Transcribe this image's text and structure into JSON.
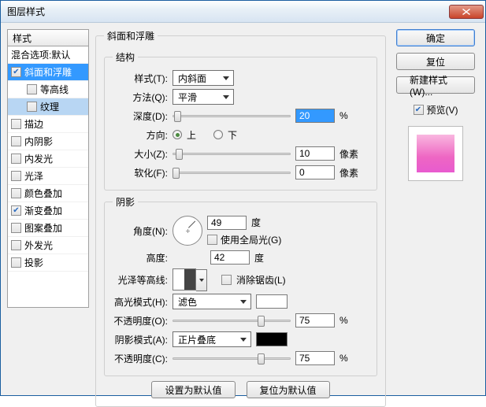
{
  "window": {
    "title": "图层样式"
  },
  "sidebar": {
    "header": "样式",
    "items": [
      {
        "label": "混合选项:默认",
        "checked": null
      },
      {
        "label": "斜面和浮雕",
        "checked": true
      },
      {
        "label": "等高线",
        "checked": false
      },
      {
        "label": "纹理",
        "checked": false
      },
      {
        "label": "描边",
        "checked": false
      },
      {
        "label": "内阴影",
        "checked": false
      },
      {
        "label": "内发光",
        "checked": false
      },
      {
        "label": "光泽",
        "checked": false
      },
      {
        "label": "颜色叠加",
        "checked": false
      },
      {
        "label": "渐变叠加",
        "checked": true
      },
      {
        "label": "图案叠加",
        "checked": false
      },
      {
        "label": "外发光",
        "checked": false
      },
      {
        "label": "投影",
        "checked": false
      }
    ]
  },
  "panel": {
    "title": "斜面和浮雕",
    "structure": {
      "legend": "结构",
      "style_label": "样式(T):",
      "style_value": "内斜面",
      "method_label": "方法(Q):",
      "method_value": "平滑",
      "depth_label": "深度(D):",
      "depth_value": "20",
      "depth_unit": "%",
      "direction_label": "方向:",
      "dir_up": "上",
      "dir_down": "下",
      "size_label": "大小(Z):",
      "size_value": "10",
      "size_unit": "像素",
      "soften_label": "软化(F):",
      "soften_value": "0",
      "soften_unit": "像素"
    },
    "shading": {
      "legend": "阴影",
      "angle_label": "角度(N):",
      "angle_value": "49",
      "angle_unit": "度",
      "global_label": "使用全局光(G)",
      "altitude_label": "高度:",
      "altitude_value": "42",
      "altitude_unit": "度",
      "gloss_label": "光泽等高线:",
      "antialias_label": "消除锯齿(L)",
      "highlight_mode_label": "高光模式(H):",
      "highlight_mode_value": "滤色",
      "highlight_opacity_label": "不透明度(O):",
      "highlight_opacity_value": "75",
      "highlight_opacity_unit": "%",
      "shadow_mode_label": "阴影模式(A):",
      "shadow_mode_value": "正片叠底",
      "shadow_opacity_label": "不透明度(C):",
      "shadow_opacity_value": "75",
      "shadow_opacity_unit": "%"
    },
    "buttons": {
      "default": "设置为默认值",
      "reset": "复位为默认值"
    }
  },
  "right": {
    "ok": "确定",
    "cancel": "复位",
    "newstyle": "新建样式(W)...",
    "preview_label": "预览(V)"
  }
}
